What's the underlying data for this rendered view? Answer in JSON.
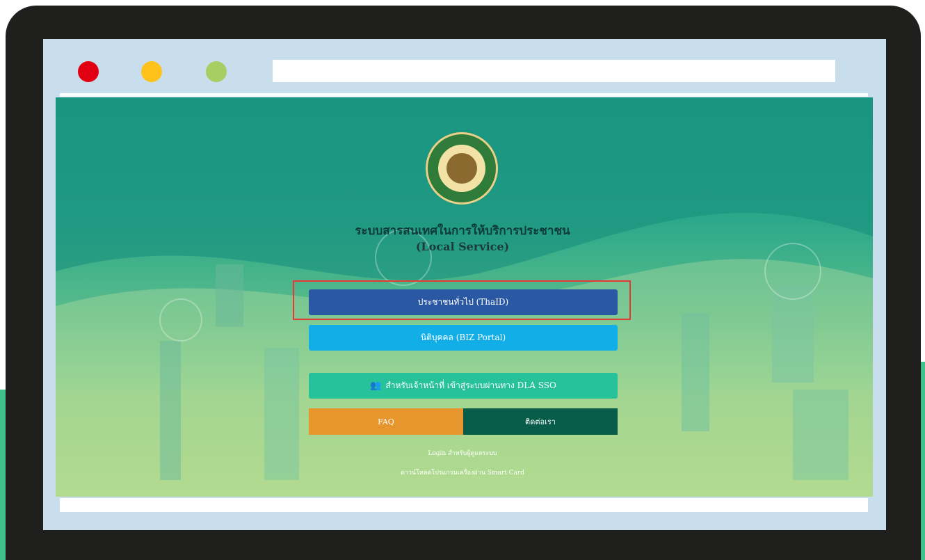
{
  "app": {
    "title_th": "ระบบสารสนเทศในการให้บริการประชาชน",
    "title_en": "(Local Service)"
  },
  "buttons": {
    "thaid": "ประชาชนทั่วไป (ThaID)",
    "biz": "นิติบุคคล (BIZ Portal)",
    "sso": "สำหรับเจ้าหน้าที่ เข้าสู่ระบบผ่านทาง DLA SSO",
    "faq": "FAQ",
    "contact": "ติดต่อเรา"
  },
  "links": {
    "admin_login": "Login สำหรับผู้ดูแลระบบ",
    "smart_card": "ดาวน์โหลดโปรแกรมเครื่องอ่าน Smart Card"
  },
  "icons": {
    "sso": "users-icon",
    "window_controls": [
      "close-dot",
      "minimize-dot",
      "maximize-dot"
    ]
  },
  "colors": {
    "thaid": "#2a58a3",
    "biz": "#12aee8",
    "sso": "#27c19a",
    "faq": "#e6962c",
    "contact": "#075c4a",
    "highlight": "#e53935"
  }
}
